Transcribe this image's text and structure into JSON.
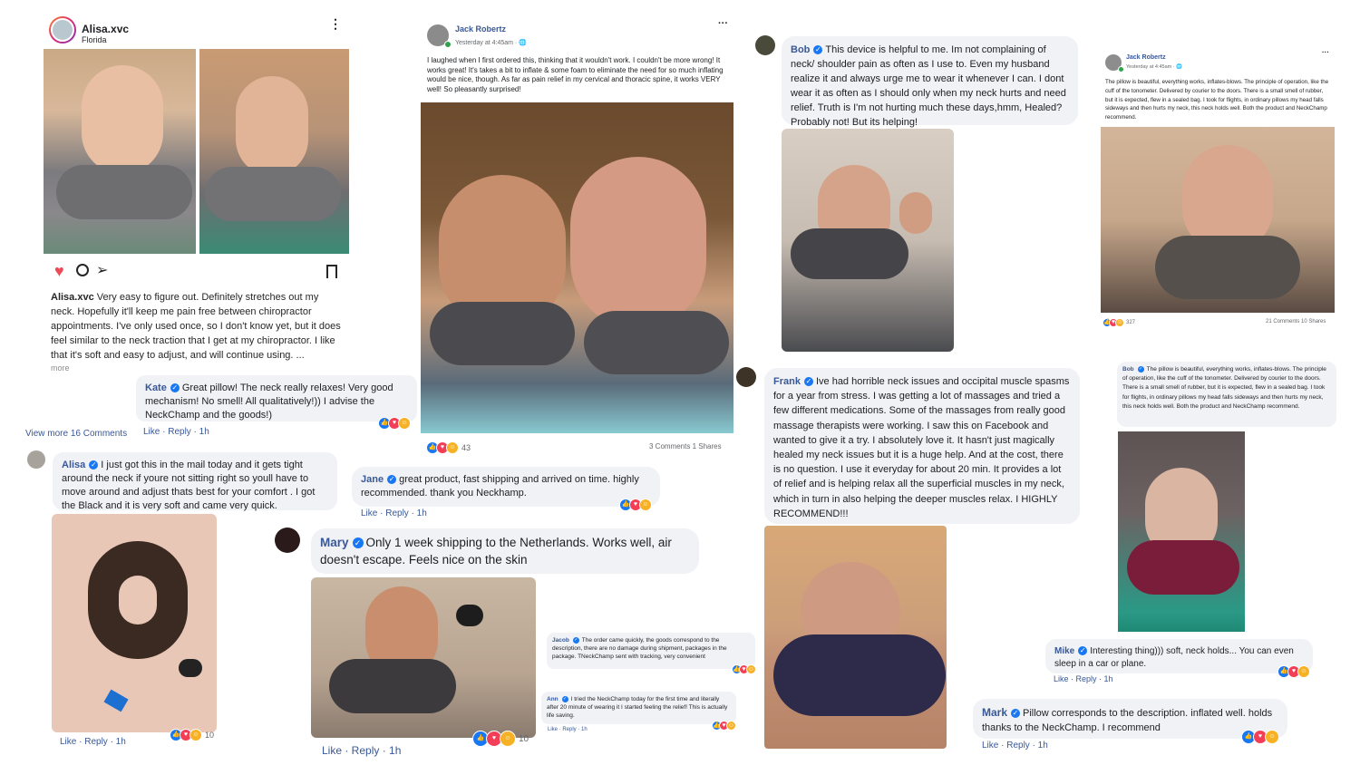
{
  "ig": {
    "username": "Alisa.xvc",
    "location": "Florida",
    "caption_user": "Alisa.xvc",
    "caption": "Very easy to figure out. Definitely stretches out my neck. Hopefully it'll keep me pain free between chiropractor appointments. I've only used once, so I don't know yet, but it does feel similar to the neck traction that I get at my chiropractor. I like that it's soft and easy to adjust, and will continue using. ...",
    "more": "more",
    "view_more": "View more 16 Comments"
  },
  "kate": {
    "name": "Kate",
    "text": "Great pillow! The neck really relaxes! Very good mechanism! No smell! All qualitatively!)) I advise the NeckChamp and the goods!)",
    "meta": "Like · Reply · 1h"
  },
  "alisa": {
    "name": "Alisa",
    "text": "I just got this in the mail today and it gets tight around the neck if youre not sitting right so youll have to move around and adjust thats best for your comfort . I got the Black and it is very soft and came very quick.",
    "meta": "Like · Reply · 1h",
    "count": "10"
  },
  "jack1": {
    "name": "Jack Robertz",
    "time": "Yesterday at 4:45am ·",
    "text": "I laughed when I first ordered this, thinking that it wouldn't work. I couldn't be more wrong! It works great! It's takes a bit to inflate & some foam to eliminate the need for so much inflating would be nice, though. As far as pain relief in my cervical and thoracic spine, it works VERY well! So pleasantly surprised!",
    "count": "43",
    "stats": "3 Comments 1 Shares"
  },
  "jane": {
    "name": "Jane",
    "text": "great product, fast shipping and arrived on time. highly recommended. thank you Neckhamp.",
    "meta": "Like · Reply · 1h"
  },
  "mary": {
    "name": "Mary",
    "text": "Only 1 week shipping to the Netherlands. Works well, air doesn't escape. Feels nice on the skin",
    "meta": "Like · Reply · 1h",
    "count": "10"
  },
  "jacob": {
    "name": "Jacob",
    "text": "The order came quickly, the goods correspond to the description, there are no damage during shipment, packages in the package. TNeckChamp sent with tracking, very convenient"
  },
  "ann": {
    "name": "Ann",
    "text": "I tried the NeckChamp today for the first time and literally after 20 minute of wearing it I started feeling the relief! This is actually life saving.",
    "meta": "Like · Reply · 1h"
  },
  "bob1": {
    "name": "Bob",
    "text": "This device is helpful to me. Im not complaining of neck/ shoulder pain as often as I use to. Even my husband realize it and always urge me to wear it whenever I can. I dont wear it as often as I should only when my neck hurts and need relief. Truth is I'm not hurting much these days,hmm, Healed? Probably not! But its helping!"
  },
  "frank": {
    "name": "Frank",
    "text": "Ive had horrible neck issues and occipital muscle spasms for a year from stress. I was getting a lot of massages and tried a few different medications. Some of the massages from really good massage therapists were working. I saw this on Facebook and wanted to give it a try. I absolutely love it. It hasn't just magically healed my neck issues but it is a huge help. And at the cost, there is no question. I use it everyday for about 20 min. It provides a lot of relief and is helping relax all the superficial muscles in my neck, which in turn in also helping the deeper muscles relax. I HIGHLY RECOMMEND!!!"
  },
  "jack2": {
    "name": "Jack Robertz",
    "time": "Yesterday at 4:45am ·",
    "text": "The pillow is beautiful, everything works, inflates-blows. The principle of operation, like the cuff of the tonometer. Delivered by courier to the doors. There is a small smell of rubber, but it is expected, flew in a sealed bag. I took for flights, in ordinary pillows my head falls sideways and then hurts my neck, this neck holds well. Both the product and NeckChamp recommend.",
    "count": "327",
    "stats": "21 Comments 10 Shares"
  },
  "bob2": {
    "name": "Bob",
    "text": "The pillow is beautiful, everything works, inflates-blows. The principle of operation, like the cuff of the tonometer. Delivered by courier to the doors. There is a small smell of rubber, but it is expected, flew in a sealed bag. I took for flights, in ordinary pillows my head falls sideways and then hurts my neck, this neck holds well. Both the product and NeckChamp recommend."
  },
  "mike": {
    "name": "Mike",
    "text": "Interesting thing))) soft, neck holds... You can even sleep in a car or plane.",
    "meta": "Like · Reply · 1h"
  },
  "mark": {
    "name": "Mark",
    "text": "Pillow corresponds to the description. inflated well. holds thanks to the NeckChamp. I recommend",
    "meta": "Like · Reply · 1h"
  },
  "colors": {
    "fb_blue": "#385898",
    "bubble": "#f0f2f5",
    "like": "#1877f2",
    "love": "#f33e58",
    "haha": "#f7b125"
  }
}
